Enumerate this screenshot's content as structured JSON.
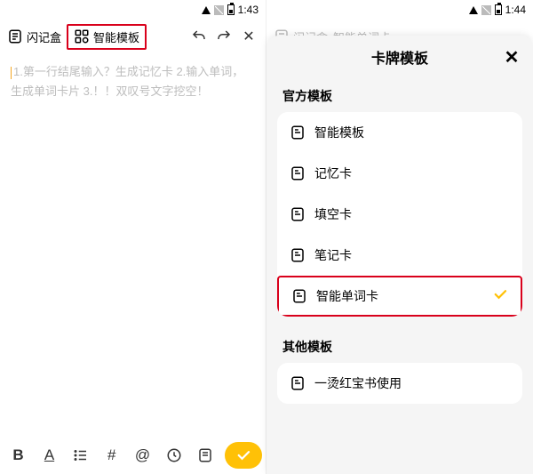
{
  "status": {
    "time": "1:43",
    "time2": "1:44"
  },
  "left": {
    "brand_label": "闪记盒",
    "template_label": "智能模板",
    "undo": "↶",
    "redo": "↷",
    "close": "✕",
    "placeholder": "1.第一行结尾输入？生成记忆卡 2.输入单词，生成单词卡片 3.！！双叹号文字挖空！",
    "format": {
      "bold": "B",
      "underline": "A",
      "list": "≡",
      "hash": "#",
      "at": "@"
    }
  },
  "right": {
    "brand_label": "闪记盒",
    "template_label": "智能单词卡",
    "overlay_title": "卡牌模板",
    "close": "✕",
    "section_official": "官方模板",
    "section_other": "其他模板",
    "items": [
      {
        "label": "智能模板"
      },
      {
        "label": "记忆卡"
      },
      {
        "label": "填空卡"
      },
      {
        "label": "笔记卡"
      },
      {
        "label": "智能单词卡",
        "selected": true
      }
    ],
    "other_items": [
      {
        "label": "一烫红宝书使用"
      }
    ]
  }
}
